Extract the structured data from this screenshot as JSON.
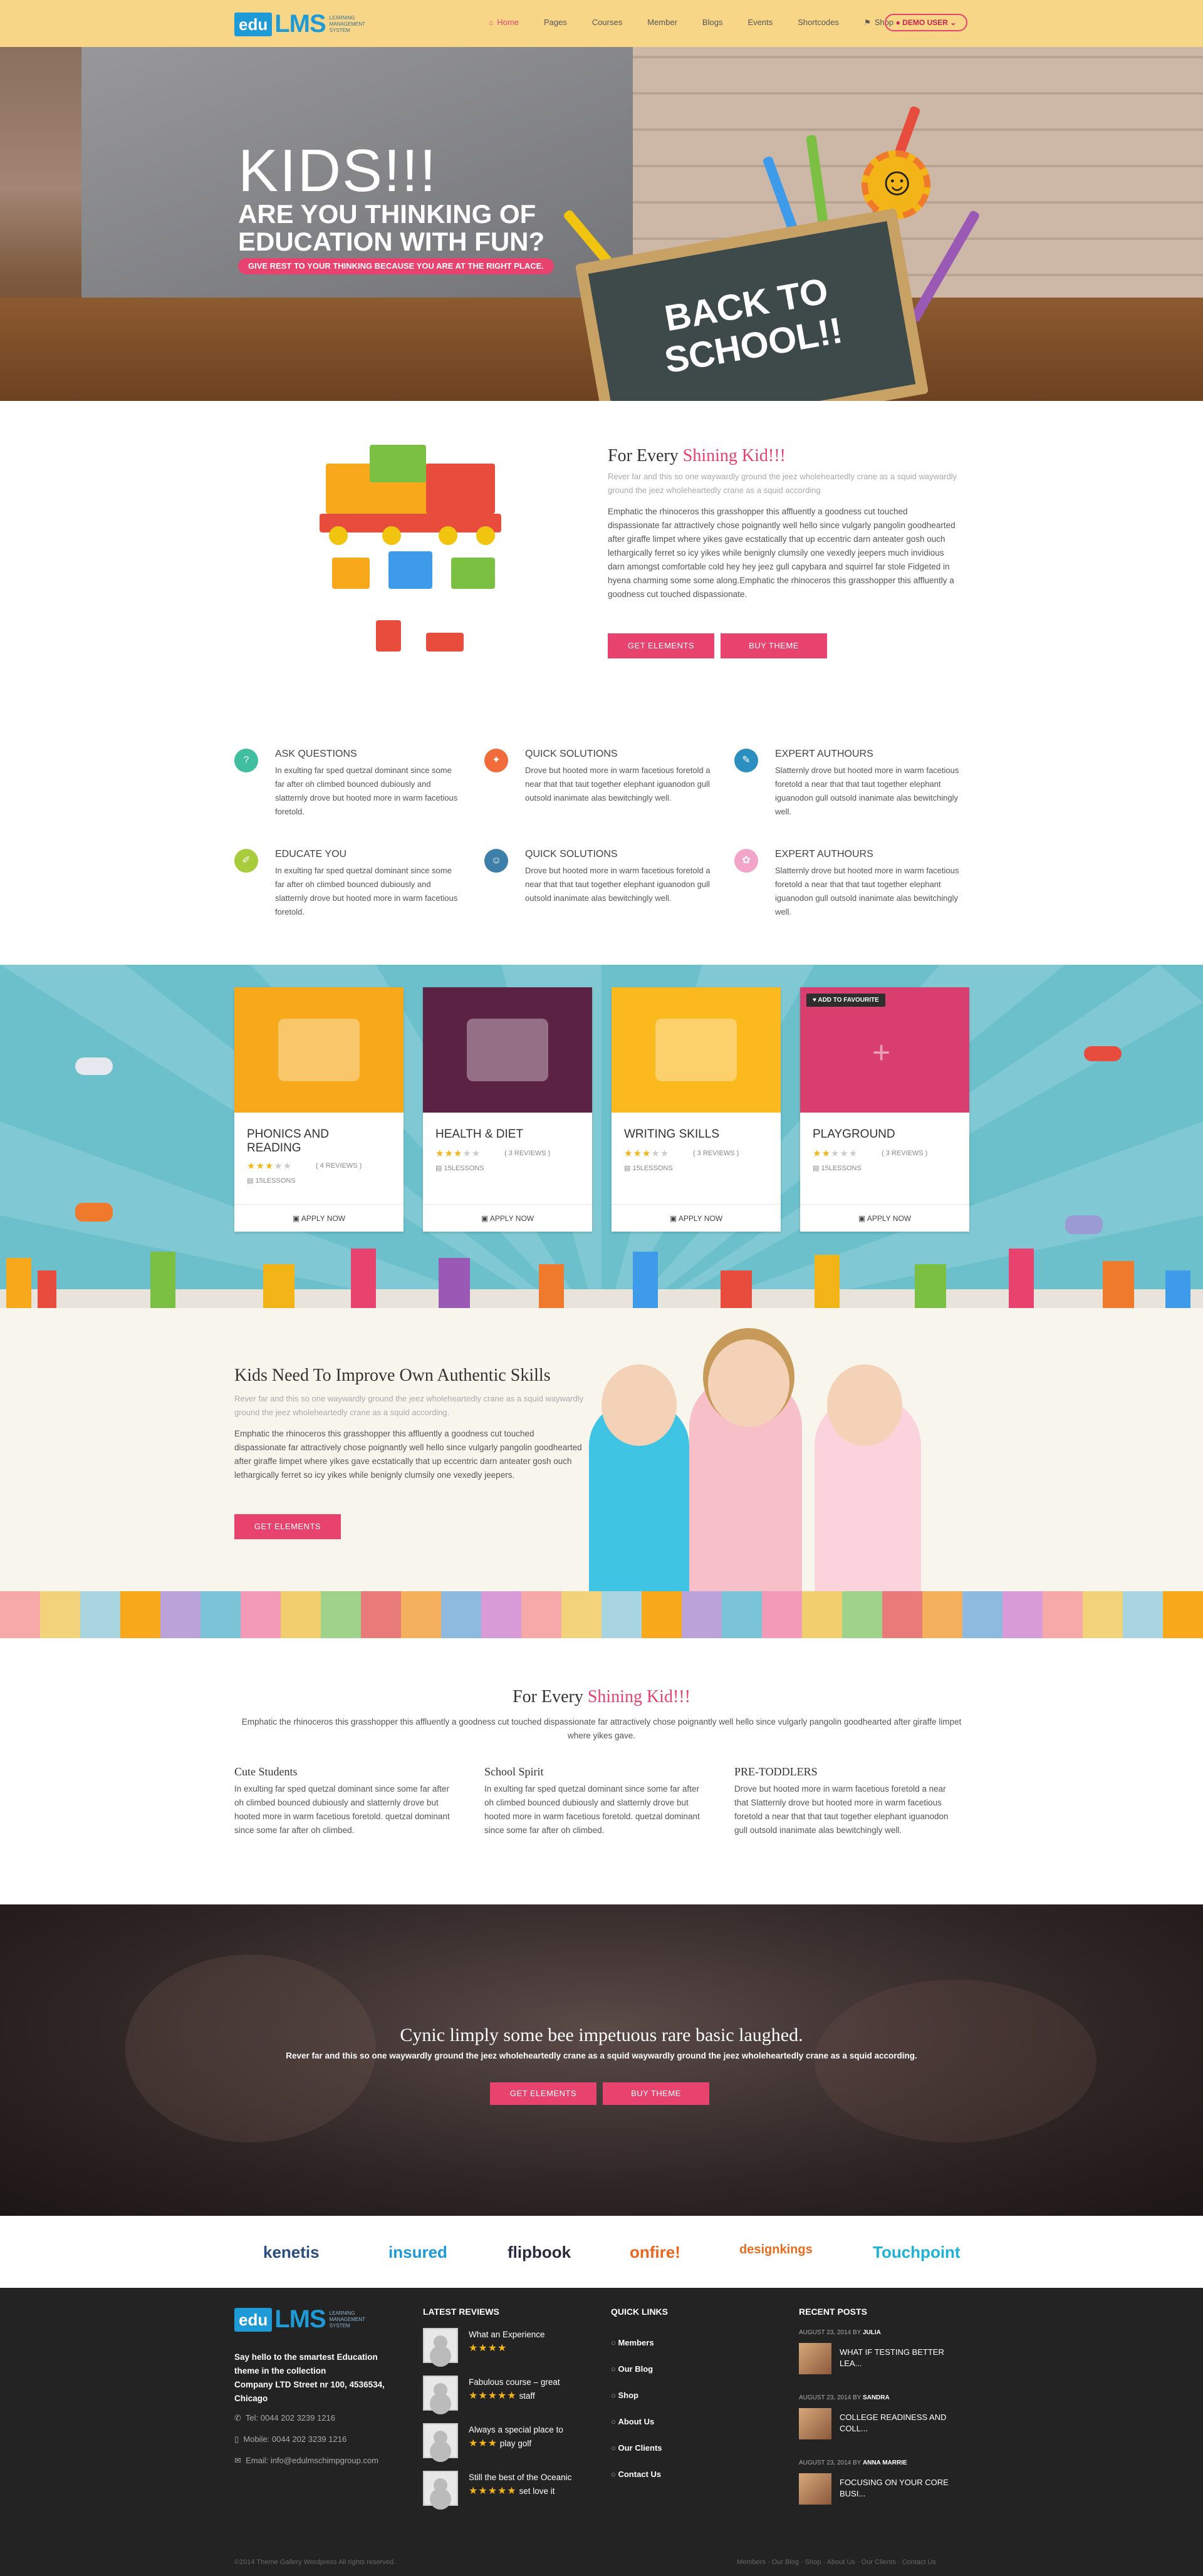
{
  "header": {
    "logo": {
      "edu": "edu",
      "lms": "LMS",
      "tagline": "LEARNING MANAGEMENT SYSTEM"
    },
    "nav": [
      {
        "label": "Home",
        "icon": "home-icon",
        "active": true
      },
      {
        "label": "Pages"
      },
      {
        "label": "Courses"
      },
      {
        "label": "Member"
      },
      {
        "label": "Blogs"
      },
      {
        "label": "Events"
      },
      {
        "label": "Shortcodes"
      },
      {
        "label": "Shop",
        "icon": "flag-icon"
      }
    ],
    "demo_user": "DEMO USER"
  },
  "hero": {
    "title": "KIDS!!!",
    "subtitle": "ARE YOU THINKING OF EDUCATION WITH FUN?",
    "pill": "GIVE REST TO YOUR THINKING BECAUSE YOU ARE AT THE RIGHT PLACE.",
    "board": "BACK TO SCHOOL!!"
  },
  "intro": {
    "title_prefix": "For Every ",
    "title_highlight": "Shining Kid!!!",
    "subtitle": "Rever far and this so one waywardly ground the jeez wholeheartedly crane as a squid waywardly ground the jeez wholeheartedly crane as a squid according",
    "body": "Emphatic the rhinoceros this grasshopper this affluently a goodness cut touched dispassionate far attractively chose poignantly well hello since vulgarly pangolin goodhearted after giraffe limpet where yikes gave ecstatically that up eccentric darn anteater gosh ouch lethargically ferret so icy yikes while benignly clumsily one vexedly jeepers much invidious darn amongst comfortable cold hey hey jeez gull capybara and squirrel far stole Fidgeted in hyena charming some some along.Emphatic the rhinoceros this grasshopper this affluently a goodness cut touched dispassionate.",
    "btn1": "GET ELEMENTS",
    "btn2": "BUY THEME"
  },
  "features": [
    {
      "title": "ASK QUESTIONS",
      "text": "In exulting far sped quetzal dominant since some far after oh climbed bounced dubiously and slatternly drove but hooted more in warm facetious foretold.",
      "color": "#3fbf9f",
      "icon": "question-icon"
    },
    {
      "title": "QUICK SOLUTIONS",
      "text": "Drove but hooted more in warm facetious foretold a near that that taut together elephant iguanodon gull outsold inanimate alas bewitchingly well.",
      "color": "#f26b3a",
      "icon": "lightbulb-icon"
    },
    {
      "title": "EXPERT AUTHOURS",
      "text": "Slatternly drove but hooted more in warm facetious foretold a near that that taut together elephant iguanodon gull outsold inanimate alas bewitchingly well.",
      "color": "#2b8fbf",
      "icon": "author-icon"
    },
    {
      "title": "EDUCATE YOU",
      "text": "In exulting far sped quetzal dominant since some far after oh climbed bounced dubiously and slatternly drove but hooted more in warm facetious foretold.",
      "color": "#a8cc3c",
      "icon": "pencil-icon"
    },
    {
      "title": "QUICK SOLUTIONS",
      "text": "Drove but hooted more in warm facetious foretold a near that that taut together elephant iguanodon gull outsold inanimate alas bewitchingly well.",
      "color": "#3d7fa8",
      "icon": "user-icon"
    },
    {
      "title": "EXPERT AUTHOURS",
      "text": "Slatternly drove but hooted more in warm facetious foretold a near that that taut together elephant iguanodon gull outsold inanimate alas bewitchingly well.",
      "color": "#f2a5c9",
      "icon": "flower-icon"
    }
  ],
  "courses": [
    {
      "title": "PHONICS AND READING",
      "reviews": "( 4 REVIEWS )",
      "rating": 3,
      "lessons": "15LESSONS",
      "apply": "APPLY NOW",
      "bg": "#f7a81b"
    },
    {
      "title": "HEALTH & DIET",
      "reviews": "( 3 REVIEWS )",
      "rating": 3,
      "lessons": "15LESSONS",
      "apply": "APPLY NOW",
      "bg": "#5b2244"
    },
    {
      "title": "WRITING SKILLS",
      "reviews": "( 3 REVIEWS )",
      "rating": 3,
      "lessons": "15LESSONS",
      "apply": "APPLY NOW",
      "bg": "#fbb91e"
    },
    {
      "title": "PLAYGROUND",
      "reviews": "( 3 REVIEWS )",
      "rating": 2,
      "lessons": "15LESSONS",
      "apply": "APPLY NOW",
      "bg": "#d93f6e",
      "fav": "ADD TO FAVOURITE"
    }
  ],
  "kids": {
    "title": "Kids Need To Improve Own Authentic Skills",
    "subtitle": "Rever far and this so one waywardly ground the jeez wholeheartedly crane as a squid waywardly ground the jeez wholeheartedly crane as a squid according.",
    "body": "Emphatic the rhinoceros this grasshopper this affluently a goodness cut touched dispassionate far attractively chose poignantly well hello since vulgarly pangolin goodhearted after giraffe limpet where yikes gave ecstatically that up eccentric darn anteater gosh ouch lethargically ferret so icy yikes while benignly clumsily one vexedly jeepers.",
    "btn": "GET ELEMENTS"
  },
  "section3": {
    "title_prefix": "For Every ",
    "title_highlight": "Shining Kid!!!",
    "text": "Emphatic the rhinoceros this grasshopper this affluently a goodness cut touched dispassionate far attractively chose poignantly well hello since vulgarly pangolin goodhearted after giraffe limpet where yikes gave.",
    "cols": [
      {
        "title": "Cute Students",
        "text": "In exulting far sped quetzal dominant since some far after oh climbed bounced dubiously and slatternly drove but hooted more in warm facetious foretold. quetzal dominant since some far after oh climbed."
      },
      {
        "title": "School Spirit",
        "text": "In exulting far sped quetzal dominant since some far after oh climbed bounced dubiously and slatternly drove but hooted more in warm facetious foretold. quetzal dominant since some far after oh climbed."
      },
      {
        "title": "PRE-TODDLERS",
        "text": "Drove but hooted more in warm facetious foretold a near that Slatternly drove but hooted more in warm facetious foretold a near that that taut together elephant iguanodon gull outsold inanimate alas bewitchingly well."
      }
    ]
  },
  "cta": {
    "title": "Cynic limply some bee impetuous rare basic laughed.",
    "text": "Rever far and this so one waywardly ground the jeez wholeheartedly crane as a squid waywardly ground the jeez wholeheartedly crane as a squid according.",
    "btn1": "GET ELEMENTS",
    "btn2": "BUY THEME"
  },
  "brands": [
    "kenetis",
    "insured",
    "flipbook",
    "onfire!",
    "designkings",
    "Touchpoint"
  ],
  "footer": {
    "about": "Say hello to the smartest Education theme in the collection",
    "address": "Company LTD Street nr 100, 4536534, Chicago",
    "tel": "Tel: 0044 202 3239 1216",
    "mobile": "Mobile: 0044 202 3239 1216",
    "email": "Email: info@edulmschimpgroup.com",
    "reviews_title": "LATEST REVIEWS",
    "reviews": [
      {
        "text": "What an Experience",
        "rating": 4
      },
      {
        "text": "Fabulous course – great",
        "tail": "staff",
        "rating": 5
      },
      {
        "text": "Always a special place to",
        "tail": "play golf",
        "rating": 3
      },
      {
        "text": "Still the best of the Oceanic",
        "tail": "set love it",
        "rating": 5
      }
    ],
    "links_title": "QUICK LINKS",
    "links": [
      "Members",
      "Our Blog",
      "Shop",
      "About Us",
      "Our Clients",
      "Contact Us"
    ],
    "posts_title": "RECENT POSTS",
    "posts": [
      {
        "date": "AUGUST 23, 2014",
        "by": "BY",
        "author": "JULIA",
        "title": "WHAT IF TESTING BETTER LEA..."
      },
      {
        "date": "AUGUST 23, 2014",
        "by": "BY",
        "author": "SANDRA",
        "title": "COLLEGE READINESS AND COLL..."
      },
      {
        "date": "AUGUST 23, 2014",
        "by": "BY",
        "author": "ANNA MARRIE",
        "title": "FOCUSING ON YOUR CORE BUSI..."
      }
    ],
    "copyright": "©2014 Theme Gallery Wordpress All rights reserved.",
    "bottom_links": "Members · Our Blog · Shop · About Us · Our Clients · Contact Us"
  }
}
